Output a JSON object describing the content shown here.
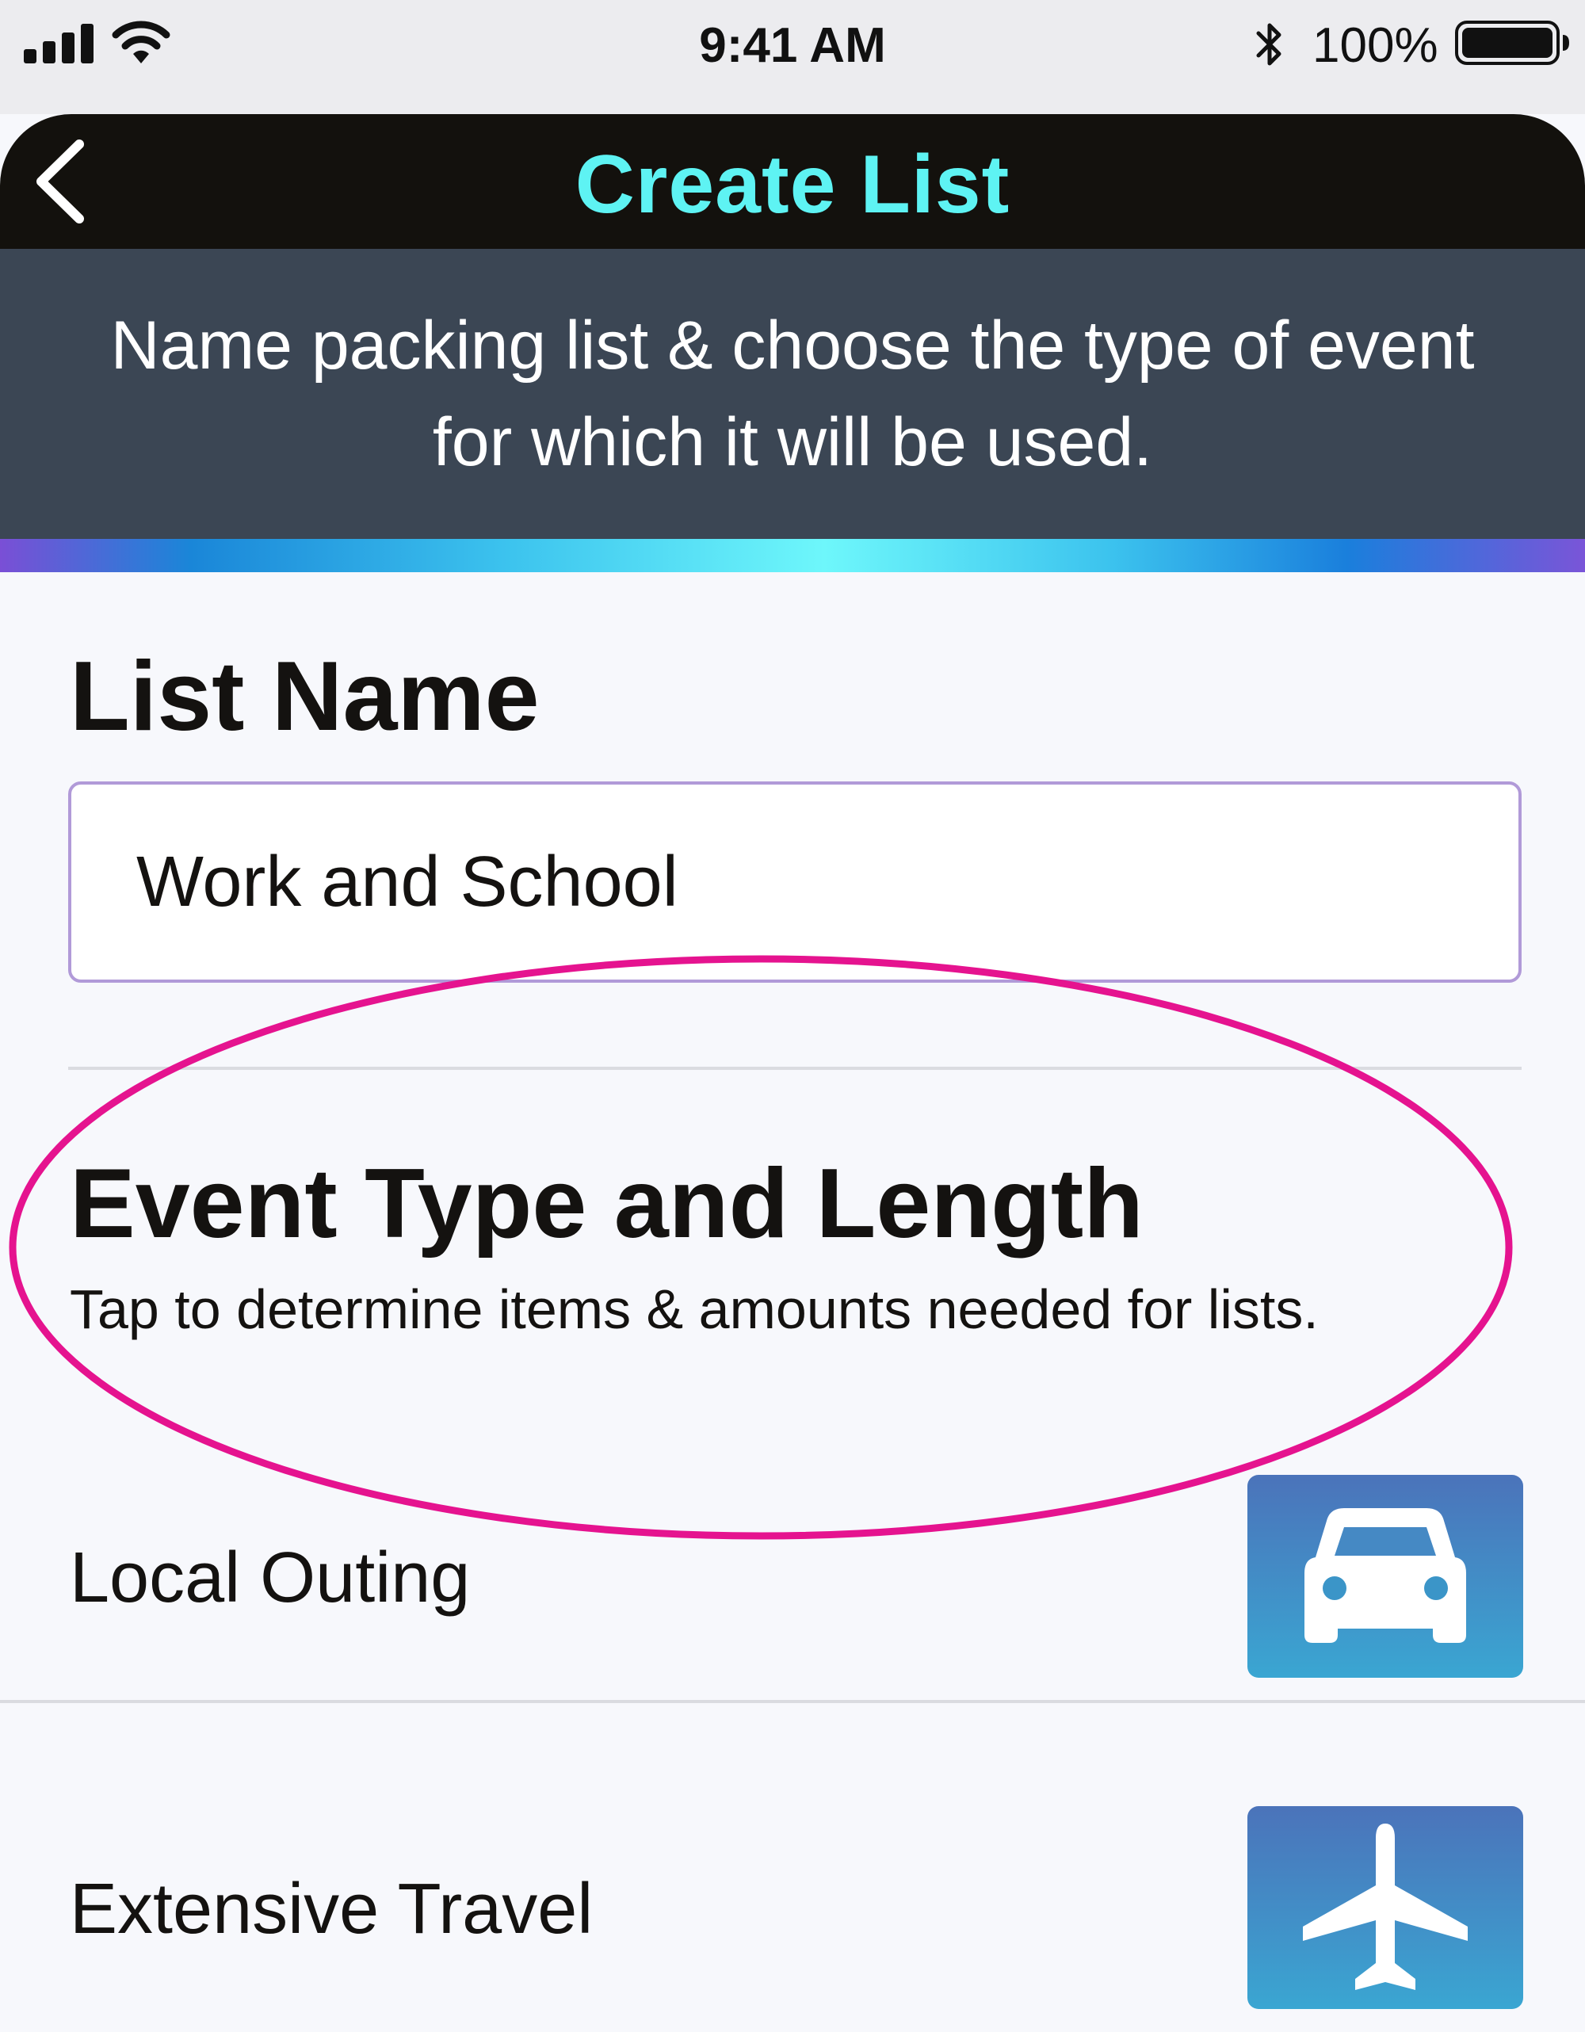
{
  "status_bar": {
    "time": "9:41 AM",
    "battery_percent": "100%",
    "signal_icon": "cellular-signal-icon",
    "wifi_icon": "wifi-icon",
    "bluetooth_icon": "bluetooth-icon",
    "battery_icon": "battery-icon",
    "battery_level": 1.0
  },
  "nav": {
    "title": "Create List",
    "back_icon": "chevron-left-icon"
  },
  "instructions": {
    "text": "Name packing list & choose the type of event for which it will be used."
  },
  "list_name": {
    "heading": "List Name",
    "value": "Work and School"
  },
  "event_section": {
    "heading": "Event Type and Length",
    "subtitle": "Tap to determine items & amounts needed for lists."
  },
  "event_types": [
    {
      "label": "Local Outing",
      "icon": "car-icon"
    },
    {
      "label": "Extensive Travel",
      "icon": "airplane-icon"
    }
  ],
  "colors": {
    "nav_background": "#13110d",
    "title_color": "#5ef3f3",
    "instructions_background": "#3b4654",
    "input_border": "#b19ad8",
    "tile_gradient_top": "#4b73ba",
    "tile_gradient_bottom": "#3aa6d2",
    "annotation_ellipse": "#e5138f"
  }
}
